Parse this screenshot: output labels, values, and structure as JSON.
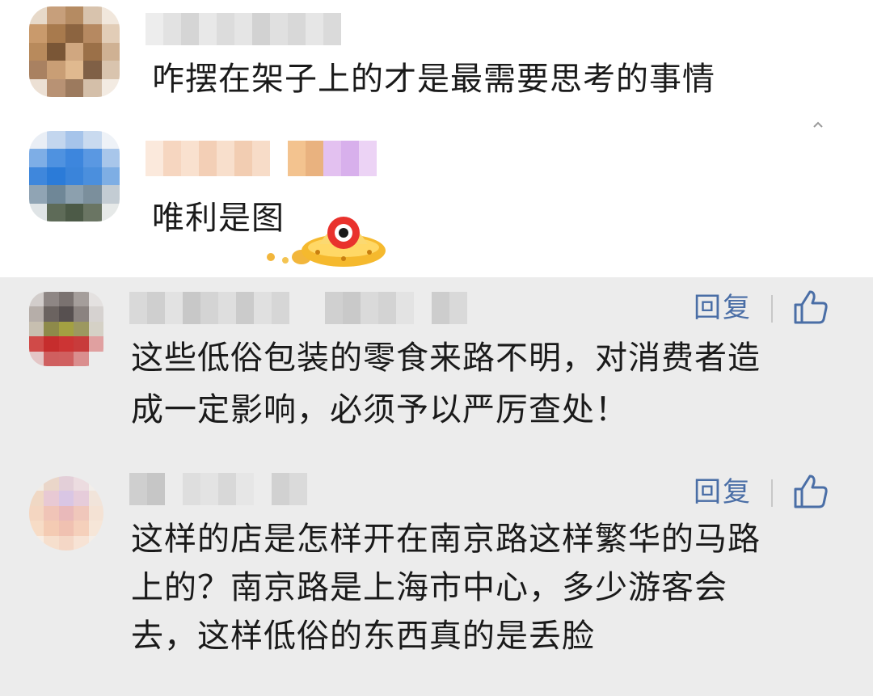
{
  "comments": [
    {
      "text": "咋摆在架子上的才是最需要思考的事情"
    },
    {
      "text": "唯利是图"
    },
    {
      "text": "这些低俗包装的零食来路不明，对消费者造\n成一定影响，必须予以严厉查处！",
      "reply_label": "回复"
    },
    {
      "text": "这样的店是怎样开在南京路这样繁华的马路\n上的？南京路是上海市中心，多少游客会\n去，这样低俗的东西真的是丢脸",
      "reply_label": "回复"
    }
  ],
  "icons": {
    "like": "thumbs-up-icon",
    "sticker": "ufo-emoji-sticker",
    "avatar": "pixelated-avatar"
  },
  "colors": {
    "reply": "#4a6ea6",
    "highlight_bg": "#ececec"
  }
}
